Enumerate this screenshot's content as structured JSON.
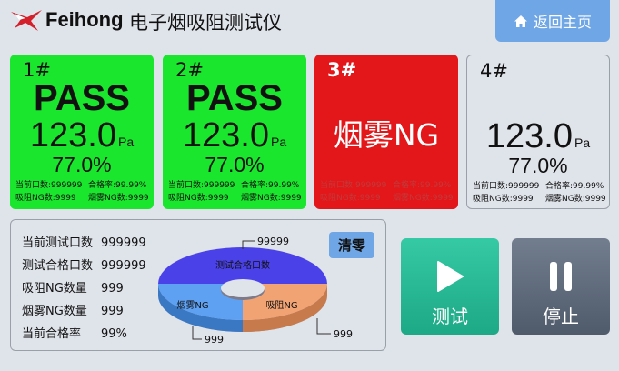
{
  "header": {
    "brand": "Feihong",
    "title": "电子烟吸阻测试仪",
    "home_label": "返回主页"
  },
  "stations": [
    {
      "id": "1#",
      "status": "pass",
      "result": "PASS",
      "pressure": "123.0",
      "unit": "Pa",
      "rate": "77.0%",
      "current_count": "当前口数:999999",
      "pass_rate": "合格率:99.99%",
      "resist_ng": "吸阻NG数:9999",
      "smoke_ng": "烟雾NG数:9999"
    },
    {
      "id": "2#",
      "status": "pass",
      "result": "PASS",
      "pressure": "123.0",
      "unit": "Pa",
      "rate": "77.0%",
      "current_count": "当前口数:999999",
      "pass_rate": "合格率:99.99%",
      "resist_ng": "吸阻NG数:9999",
      "smoke_ng": "烟雾NG数:9999"
    },
    {
      "id": "3#",
      "status": "ng",
      "result": "烟雾NG",
      "current_count": "当前口数:999999",
      "pass_rate": "合格率:99.99%",
      "resist_ng": "吸阻NG数:9999",
      "smoke_ng": "烟雾NG数:9999"
    },
    {
      "id": "4#",
      "status": "idle",
      "pressure": "123.0",
      "unit": "Pa",
      "rate": "77.0%",
      "current_count": "当前口数:999999",
      "pass_rate": "合格率:99.99%",
      "resist_ng": "吸阻NG数:9999",
      "smoke_ng": "烟雾NG数:9999"
    }
  ],
  "summary": {
    "rows": [
      {
        "label": "当前测试口数",
        "value": "999999"
      },
      {
        "label": "测试合格口数",
        "value": "999999"
      },
      {
        "label": "吸阻NG数量",
        "value": "999"
      },
      {
        "label": "烟雾NG数量",
        "value": "999"
      },
      {
        "label": "当前合格率",
        "value": "99%"
      }
    ],
    "clear_label": "清零",
    "pie": {
      "pass_label": "测试合格口数",
      "pass_value": "99999",
      "smoke_label": "烟雾NG",
      "smoke_value": "999",
      "resist_label": "吸阻NG",
      "resist_value": "999"
    }
  },
  "controls": {
    "test_label": "测试",
    "stop_label": "停止"
  },
  "colors": {
    "pass": "#19e62c",
    "ng": "#e3161a",
    "accent": "#6fa6e6",
    "pie_pass": "#4a42e8",
    "pie_smoke": "#5ea0f2",
    "pie_resist": "#f2a374",
    "test_button": "#27b994",
    "stop_button": "#606b7c"
  },
  "icons": {
    "home": "home-icon",
    "play": "play-icon",
    "pause": "pause-icon",
    "logo": "feihong-logo-icon"
  }
}
